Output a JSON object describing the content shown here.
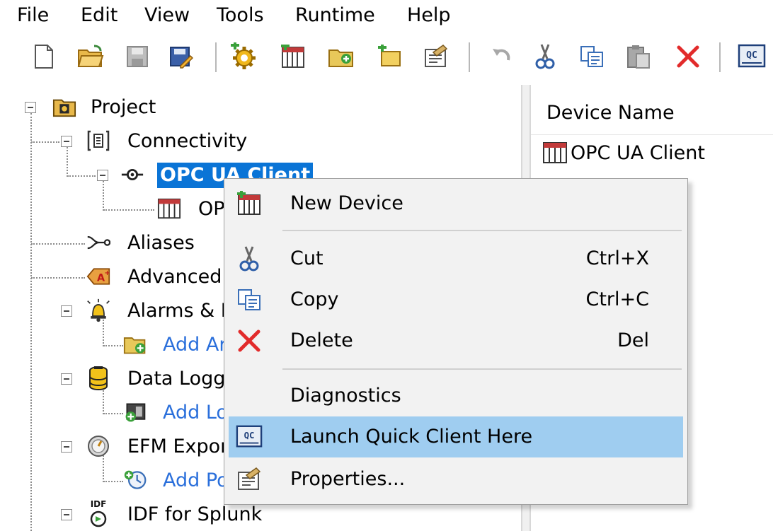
{
  "menubar": {
    "items": [
      "File",
      "Edit",
      "View",
      "Tools",
      "Runtime",
      "Help"
    ]
  },
  "toolbar": {
    "buttons": [
      {
        "icon": "new-project-icon"
      },
      {
        "icon": "open-folder-icon"
      },
      {
        "icon": "save-icon"
      },
      {
        "icon": "save-as-icon"
      },
      {
        "icon": "new-channel-icon"
      },
      {
        "icon": "new-device-icon"
      },
      {
        "icon": "new-tag-group-icon"
      },
      {
        "icon": "new-tag-icon"
      },
      {
        "icon": "properties-icon"
      },
      {
        "icon": "undo-icon"
      },
      {
        "icon": "cut-icon"
      },
      {
        "icon": "copy-icon"
      },
      {
        "icon": "paste-icon"
      },
      {
        "icon": "delete-icon"
      },
      {
        "icon": "quick-client-icon",
        "text": "QC"
      }
    ]
  },
  "tree": {
    "project": "Project",
    "connectivity": "Connectivity",
    "channel": "OPC UA Client",
    "device_partial": "OPC UA Client",
    "aliases": "Aliases",
    "advanced_tags": "Advanced Tags",
    "alarms": "Alarms & Events",
    "add_alarm": "Add Area",
    "data_logger": "Data Logger",
    "add_log": "Add Log Group",
    "efm": "EFM Exporter",
    "add_poll": "Add Poll Group",
    "idf": "IDF for Splunk",
    "idf_icon_text": "IDF"
  },
  "list": {
    "header": "Device Name",
    "rows": [
      "OPC UA Client"
    ]
  },
  "context_menu": {
    "new_device": "New Device",
    "cut": "Cut",
    "cut_accel": "Ctrl+X",
    "copy": "Copy",
    "copy_accel": "Ctrl+C",
    "delete": "Delete",
    "delete_accel": "Del",
    "diagnostics": "Diagnostics",
    "launch_qc": "Launch Quick Client Here",
    "properties": "Properties...",
    "qc_icon_text": "QC"
  },
  "colors": {
    "selection": "#0a74d6",
    "menu_highlight": "#9fcdf0",
    "link": "#2a6fdb",
    "delete_red": "#e22b2b"
  }
}
